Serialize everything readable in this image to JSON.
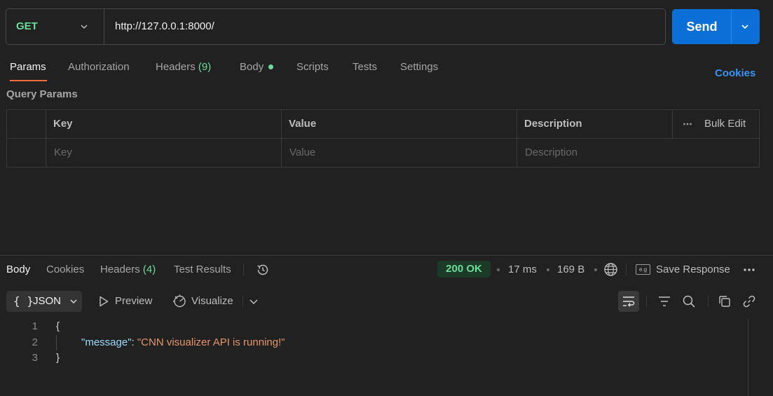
{
  "request": {
    "method": "GET",
    "url": "http://127.0.0.1:8000/",
    "send_label": "Send"
  },
  "request_tabs": {
    "params": "Params",
    "authorization": "Authorization",
    "headers": "Headers",
    "headers_count": "(9)",
    "body": "Body",
    "scripts": "Scripts",
    "tests": "Tests",
    "settings": "Settings",
    "cookies": "Cookies"
  },
  "query_params": {
    "title": "Query Params",
    "columns": [
      "Key",
      "Value",
      "Description"
    ],
    "bulk_edit": "Bulk Edit",
    "placeholders": [
      "Key",
      "Value",
      "Description"
    ]
  },
  "response": {
    "tabs": {
      "body": "Body",
      "cookies": "Cookies",
      "headers": "Headers",
      "headers_count": "(4)",
      "test_results": "Test Results"
    },
    "status": "200 OK",
    "time": "17 ms",
    "size": "169 B",
    "save_response": "Save Response",
    "format": "JSON",
    "preview": "Preview",
    "visualize": "Visualize",
    "lines": [
      {
        "number": "1",
        "text": "{"
      },
      {
        "number": "2",
        "key": "\"message\"",
        "sep": ": ",
        "value": "\"CNN visualizer API is running!\""
      },
      {
        "number": "3",
        "text": "}"
      }
    ]
  },
  "colors": {
    "accent": "#ff6c37",
    "send": "#0b6fd8",
    "method": "#6bdd9a",
    "link": "#3b93f2"
  },
  "icons": [
    "chevron-down-icon",
    "history-icon",
    "globe-icon",
    "eg-icon",
    "more-icon",
    "play-icon",
    "visualize-icon",
    "wrap-icon",
    "filter-icon",
    "search-icon",
    "copy-icon",
    "link-icon"
  ]
}
